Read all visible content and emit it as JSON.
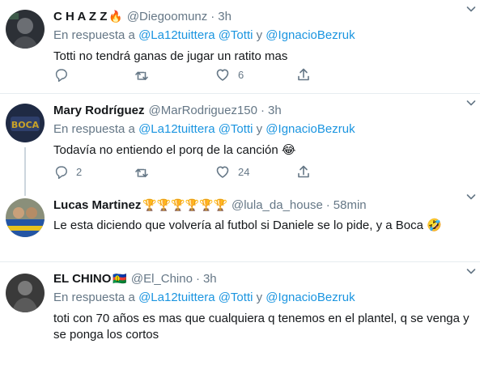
{
  "tweets": [
    {
      "name": "C H A Z Z",
      "badge": "🔥",
      "handle": "@Diegoomunz",
      "time": "3h",
      "reply_prefix": "En respuesta a",
      "mention1": "@La12tuittera",
      "mention2": "@Totti",
      "reply_and": "y",
      "mention3": "@IgnacioBezruk",
      "text": "Totti no tendrá ganas de jugar un ratito mas",
      "reply_count": "",
      "retweet_count": "",
      "like_count": "6"
    },
    {
      "name": "Mary Rodríguez",
      "handle": "@MarRodriguez150",
      "time": "3h",
      "reply_prefix": "En respuesta a",
      "mention1": "@La12tuittera",
      "mention2": "@Totti",
      "reply_and": "y",
      "mention3": "@IgnacioBezruk",
      "text": "Todavía no entiendo el porq de la canción 😂",
      "reply_count": "2",
      "retweet_count": "",
      "like_count": "24"
    },
    {
      "name": "Lucas Martinez",
      "badge": "🏆🏆🏆🏆🏆🏆",
      "handle": "@lula_da_house",
      "time": "58min",
      "text": "Le esta diciendo que volvería al futbol si Daniele se lo pide, y a Boca 🤣"
    },
    {
      "name": "EL CHINO",
      "badge": "🇳🇨",
      "handle": "@El_Chino",
      "time": "3h",
      "reply_prefix": "En respuesta a",
      "mention1": "@La12tuittera",
      "mention2": "@Totti",
      "reply_and": "y",
      "mention3": "@IgnacioBezruk",
      "text_line1": "toti con 70 años es mas que cualquiera q tenemos en el plantel, q se venga y",
      "text_line2": "se ponga los cortos"
    }
  ],
  "separator": "·",
  "icons": [
    "reply-icon",
    "retweet-icon",
    "like-icon",
    "share-icon",
    "caret-down-icon"
  ],
  "colors": {
    "link": "#1b95e0",
    "secondary": "#657786",
    "border": "#e6ecf0"
  }
}
